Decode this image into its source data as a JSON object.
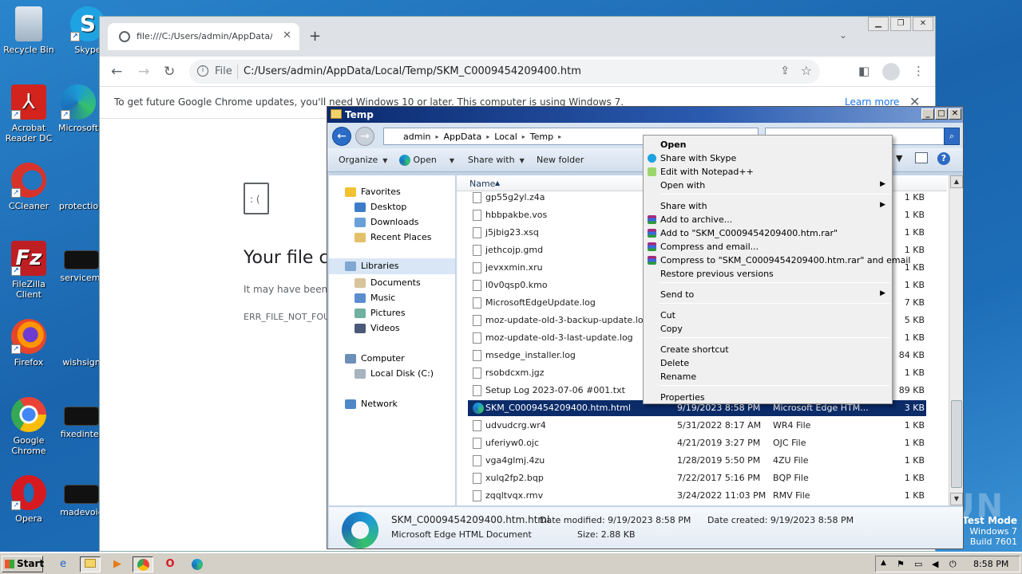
{
  "desktop": {
    "icons": [
      {
        "label": "Recycle Bin",
        "icon": "recycle-bin-icon"
      },
      {
        "label": "Skype",
        "icon": "skype-icon"
      },
      {
        "label": "Acrobat Reader DC",
        "icon": "acrobat-icon"
      },
      {
        "label": "Microsoft",
        "icon": "edge-icon"
      },
      {
        "label": "CCleaner",
        "icon": "ccleaner-icon"
      },
      {
        "label": "protection",
        "icon": "file-icon"
      },
      {
        "label": "FileZilla Client",
        "icon": "filezilla-icon"
      },
      {
        "label": "servicemi",
        "icon": "file-icon"
      },
      {
        "label": "Firefox",
        "icon": "firefox-icon"
      },
      {
        "label": "wishsign",
        "icon": "file-icon"
      },
      {
        "label": "Google Chrome",
        "icon": "chrome-icon"
      },
      {
        "label": "fixedinter",
        "icon": "file-icon"
      },
      {
        "label": "Opera",
        "icon": "opera-icon"
      },
      {
        "label": "madevoic",
        "icon": "file-icon"
      }
    ],
    "watermark": "ANY RUN",
    "test_mode": {
      "line1": "Test Mode",
      "line2": "Windows 7",
      "line3": "Build 7601"
    }
  },
  "chrome": {
    "tab_title": "file:///C:/Users/admin/AppData/Local/Temp/SKM_C0009454209400.htm",
    "omnibox_scheme": "File",
    "url": "C:/Users/admin/AppData/Local/Temp/SKM_C0009454209400.htm",
    "infobar_message": "To get future Google Chrome updates, you'll need Windows 10 or later. This computer is using Windows 7.",
    "infobar_link": "Learn more",
    "error_title": "Your file c",
    "error_sub": "It may have been",
    "error_code": "ERR_FILE_NOT_FOU"
  },
  "explorer": {
    "title": "Temp",
    "breadcrumb": [
      "admin",
      "AppData",
      "Local",
      "Temp"
    ],
    "toolbar": {
      "organize": "Organize",
      "open": "Open",
      "share_with": "Share with",
      "new_folder": "New folder"
    },
    "nav": {
      "favorites": "Favorites",
      "desktop": "Desktop",
      "downloads": "Downloads",
      "recent": "Recent Places",
      "libraries": "Libraries",
      "documents": "Documents",
      "music": "Music",
      "pictures": "Pictures",
      "videos": "Videos",
      "computer": "Computer",
      "local_disk": "Local Disk (C:)",
      "network": "Network"
    },
    "columns": {
      "name": "Name"
    },
    "files": [
      {
        "name": "gp55g2yl.z4a",
        "date": "",
        "type": "",
        "size": "1 KB"
      },
      {
        "name": "hbbpakbe.vos",
        "date": "",
        "type": "",
        "size": "1 KB"
      },
      {
        "name": "j5jbig23.xsq",
        "date": "",
        "type": "",
        "size": "1 KB"
      },
      {
        "name": "jethcojp.gmd",
        "date": "",
        "type": "",
        "size": "1 KB"
      },
      {
        "name": "jevxxmin.xru",
        "date": "",
        "type": "",
        "size": "1 KB"
      },
      {
        "name": "l0v0qsp0.kmo",
        "date": "",
        "type": "",
        "size": "1 KB"
      },
      {
        "name": "MicrosoftEdgeUpdate.log",
        "date": "",
        "type": "",
        "size": "7 KB"
      },
      {
        "name": "moz-update-old-3-backup-update.log",
        "date": "",
        "type": "",
        "size": "5 KB"
      },
      {
        "name": "moz-update-old-3-last-update.log",
        "date": "",
        "type": "",
        "size": "1 KB"
      },
      {
        "name": "msedge_installer.log",
        "date": "",
        "type": "",
        "size": "84 KB"
      },
      {
        "name": "rsobdcxm.jgz",
        "date": "",
        "type": "",
        "size": "1 KB"
      },
      {
        "name": "Setup Log 2023-07-06 #001.txt",
        "date": "",
        "type": "",
        "size": "89 KB"
      },
      {
        "name": "SKM_C0009454209400.htm.html",
        "date": "9/19/2023 8:58 PM",
        "type": "Microsoft Edge HTM...",
        "size": "3 KB"
      },
      {
        "name": "udvudcrg.wr4",
        "date": "5/31/2022 8:17 AM",
        "type": "WR4 File",
        "size": "1 KB"
      },
      {
        "name": "uferiyw0.ojc",
        "date": "4/21/2019 3:27 PM",
        "type": "OJC File",
        "size": "1 KB"
      },
      {
        "name": "vga4glmj.4zu",
        "date": "1/28/2019 5:50 PM",
        "type": "4ZU File",
        "size": "1 KB"
      },
      {
        "name": "xulq2fp2.bqp",
        "date": "7/22/2017 5:16 PM",
        "type": "BQP File",
        "size": "1 KB"
      },
      {
        "name": "zqqltvqx.rmv",
        "date": "3/24/2022 11:03 PM",
        "type": "RMV File",
        "size": "1 KB"
      }
    ],
    "details": {
      "filename": "SKM_C0009454209400.htm.html",
      "filetype": "Microsoft Edge HTML Document",
      "modified_label": "Date modified:",
      "modified": "9/19/2023 8:58 PM",
      "created_label": "Date created:",
      "created": "9/19/2023 8:58 PM",
      "size_label": "Size:",
      "size": "2.88 KB"
    }
  },
  "context_menu": {
    "items": [
      {
        "label": "Open",
        "bold": true,
        "icon": "",
        "submenu": false
      },
      {
        "label": "Share with Skype",
        "icon": "skype-icon",
        "submenu": false
      },
      {
        "label": "Edit with Notepad++",
        "icon": "notepadpp-icon",
        "submenu": false
      },
      {
        "label": "Open with",
        "icon": "",
        "submenu": true
      },
      {
        "label": "Share with",
        "icon": "",
        "submenu": true
      },
      {
        "label": "Add to archive...",
        "icon": "winrar-icon",
        "submenu": false
      },
      {
        "label": "Add to \"SKM_C0009454209400.htm.rar\"",
        "icon": "winrar-icon",
        "submenu": false
      },
      {
        "label": "Compress and email...",
        "icon": "winrar-icon",
        "submenu": false
      },
      {
        "label": "Compress to \"SKM_C0009454209400.htm.rar\" and email",
        "icon": "winrar-icon",
        "submenu": false
      },
      {
        "label": "Restore previous versions",
        "icon": "",
        "submenu": false
      },
      {
        "label": "Send to",
        "icon": "",
        "submenu": true
      },
      {
        "label": "Cut",
        "icon": "",
        "submenu": false
      },
      {
        "label": "Copy",
        "icon": "",
        "submenu": false
      },
      {
        "label": "Create shortcut",
        "icon": "",
        "submenu": false
      },
      {
        "label": "Delete",
        "icon": "",
        "submenu": false
      },
      {
        "label": "Rename",
        "icon": "",
        "submenu": false
      },
      {
        "label": "Properties",
        "icon": "",
        "submenu": false
      }
    ]
  },
  "taskbar": {
    "start": "Start",
    "clock": "8:58 PM"
  }
}
